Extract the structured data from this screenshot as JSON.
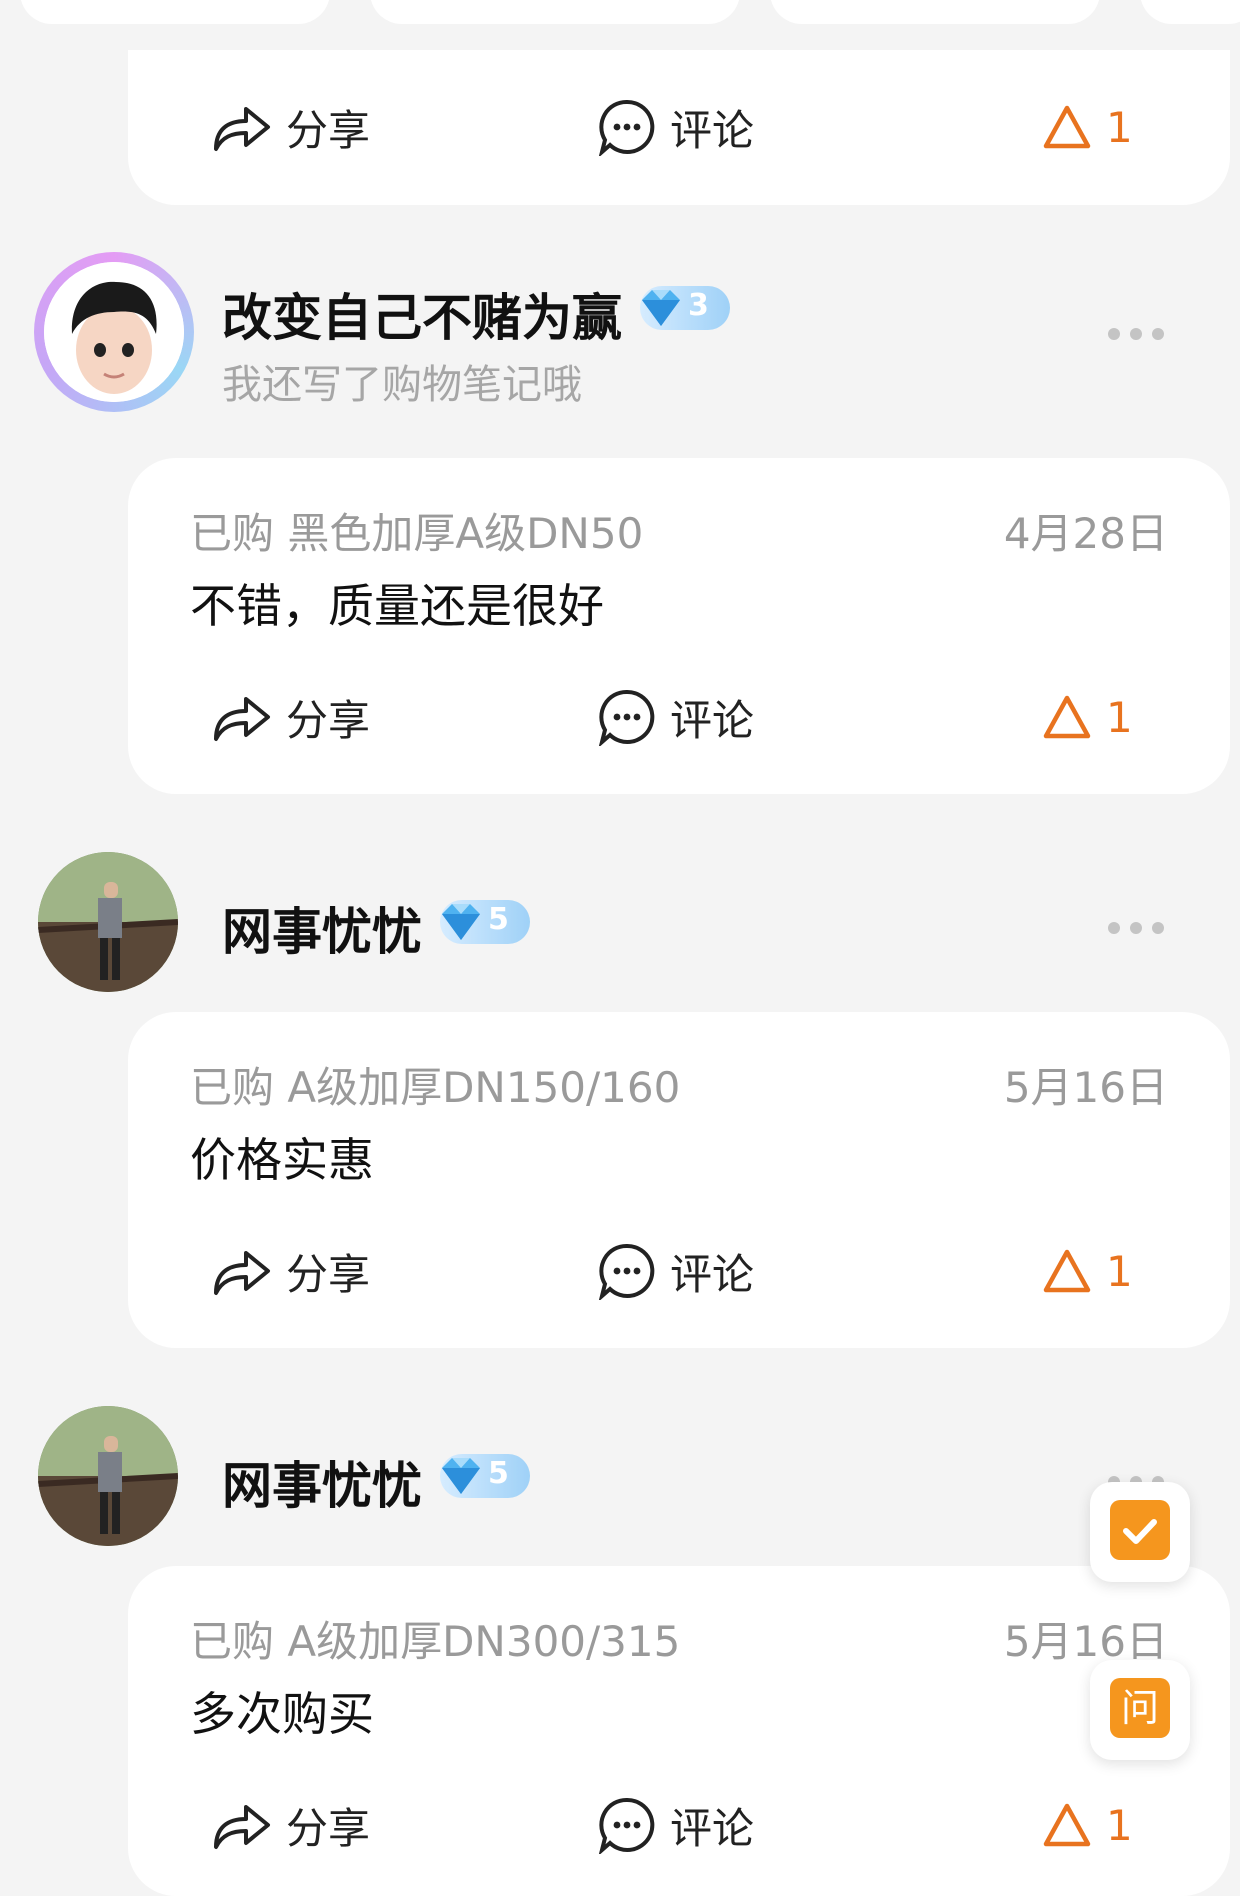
{
  "actions": {
    "share_label": "分享",
    "comment_label": "评论",
    "like_count": "1"
  },
  "reviews": [
    {
      "user": "改变自己不赌为赢",
      "level": "3",
      "note": "我还写了购物笔记哦",
      "purchase": "已购 黑色加厚A级DN50",
      "date": "4月28日",
      "text": "不错，质量还是很好"
    },
    {
      "user": "网事忧忧",
      "level": "5",
      "note": "",
      "purchase": "已购 A级加厚DN150/160",
      "date": "5月16日",
      "text": "价格实惠"
    },
    {
      "user": "网事忧忧",
      "level": "5",
      "note": "",
      "purchase": "已购 A级加厚DN300/315",
      "date": "5月16日",
      "text": "多次购买"
    }
  ],
  "floating": {
    "ask_label": "问"
  },
  "colors": {
    "accent": "#e8731f",
    "float_button": "#f5961e",
    "badge": "#9fd1f7"
  },
  "icons": [
    "share-icon",
    "comment-icon",
    "like-triangle-icon",
    "diamond-icon",
    "more-icon",
    "checklist-icon"
  ]
}
